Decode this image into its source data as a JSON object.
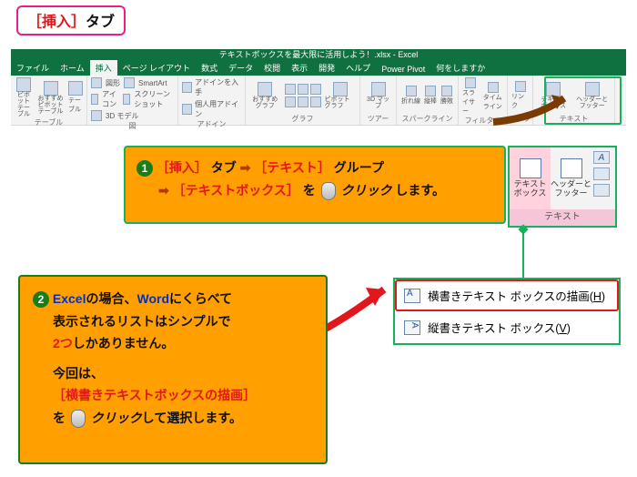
{
  "header_tag": {
    "bracket": "［挿入］",
    "rest": "タブ"
  },
  "titlebar": "テキストボックスを最大限に活用しよう！.xlsx  -  Excel",
  "tabs": {
    "file": "ファイル",
    "home": "ホーム",
    "insert": "挿入",
    "layout": "ページ レイアウト",
    "formula": "数式",
    "data": "データ",
    "review": "校閲",
    "view": "表示",
    "dev": "開発",
    "help": "ヘルプ",
    "pp": "Power Pivot",
    "tell": "何をしますか"
  },
  "ribbon": {
    "table_label": "テーブル",
    "zukei_label": "図",
    "zukei_items": [
      "図形",
      "アイコン",
      "3D モデル"
    ],
    "smartart": "SmartArt",
    "screenshot": "スクリーンショット",
    "addin_label": "アドイン",
    "addin_items": [
      "アドインを入手",
      "個人用アドイン"
    ],
    "graph_label": "グラフ",
    "graph_btn": "おすすめグラフ",
    "pivotgraph": "ピボットグラフ",
    "tour_label": "ツアー",
    "tour_btn": "3D マップ",
    "spark_label": "スパークライン",
    "spark_items": [
      "折れ線",
      "縦棒",
      "勝敗"
    ],
    "filter_label": "フィルター",
    "filter_items": [
      "スライサー",
      "タイムライン"
    ],
    "link_label": "リンク",
    "link_btn": "リンク",
    "text_label": "テキスト",
    "text_btn1": "テキスト ボックス",
    "text_btn2": "ヘッダーと フッター",
    "pivot": "ピボットテーブル",
    "pivot_reco": "おすすめ ピボットテーブル",
    "table": "テーブル"
  },
  "zoom": {
    "textbox": "テキスト ボックス",
    "header": "ヘッダーと フッター",
    "footer": "テキスト"
  },
  "callout1": {
    "n": "1",
    "p1a": "［挿入］",
    "p1b": "タブ",
    "arw": "➡",
    "p1c": "［テキスト］",
    "p1d": "グループ",
    "p2a": "［テキストボックス］",
    "p2b": "を",
    "p2c": "クリック",
    "p2d": "します。"
  },
  "dd": {
    "h_pre": "横書きテキスト ボックスの描画(",
    "h_u": "H",
    "h_post": ")",
    "v_pre": "縦書きテキスト ボックス(",
    "v_u": "V",
    "v_post": ")"
  },
  "callout2": {
    "n": "2",
    "l1a": "Excel",
    "l1b": "の場合、",
    "l1c": "Word",
    "l1d": "にくらべて",
    "l2": "表示されるリストはシンプルで",
    "l3a": "2つ",
    "l3b": "しかありません。",
    "l4": "今回は、",
    "l5": "［横書きテキストボックスの描画］",
    "l6a": "を",
    "l6b": "クリック",
    "l6c": "して選択します。"
  }
}
